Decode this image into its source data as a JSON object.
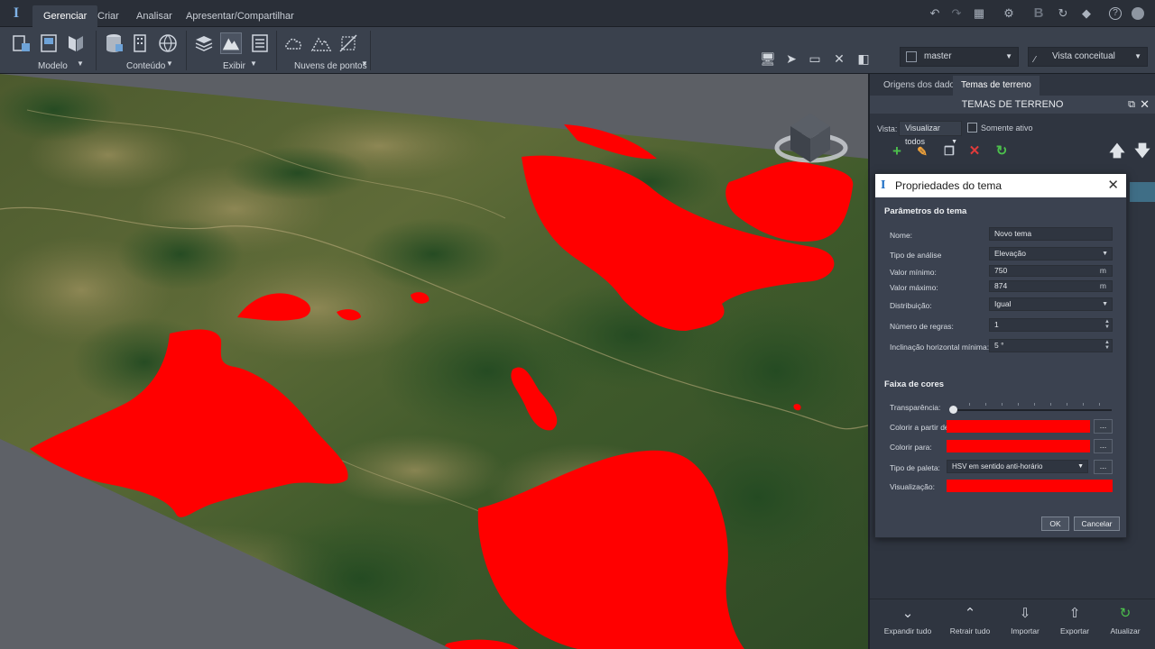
{
  "menu": {
    "tabs": [
      "Gerenciar",
      "Criar",
      "Analisar",
      "Apresentar/Compartilhar"
    ],
    "active": "Gerenciar"
  },
  "ribbon": {
    "groups": [
      "Modelo",
      "Conteúdo",
      "Exibir",
      "Nuvens de pontos"
    ],
    "branch_select": "master",
    "view_select": "Vista conceitual"
  },
  "panel": {
    "tabs": [
      "Origens dos dados",
      "Temas de terreno"
    ],
    "header": "TEMAS DE TERRENO",
    "vista_label": "Vista:",
    "vista_value": "Visualizar todos",
    "somente_ativo": "Somente ativo"
  },
  "bottom": {
    "buttons": [
      "Expandir tudo",
      "Retrair tudo",
      "Importar",
      "Exportar",
      "Atualizar"
    ]
  },
  "dialog": {
    "title": "Propriedades do tema",
    "section_params": "Parâmetros do tema",
    "nome_label": "Nome:",
    "nome_value": "Novo tema",
    "tipo_label": "Tipo de análise",
    "tipo_value": "Elevação",
    "min_label": "Valor mínimo:",
    "min_value": "750",
    "min_unit": "m",
    "max_label": "Valor máximo:",
    "max_value": "874",
    "max_unit": "m",
    "dist_label": "Distribuição:",
    "dist_value": "Igual",
    "regras_label": "Número de regras:",
    "regras_value": "1",
    "incl_label": "Inclinação horizontal mínima:",
    "incl_value": "5 °",
    "section_cores": "Faixa de cores",
    "transp_label": "Transparência:",
    "transparencia_value": 0,
    "colorir_de_label": "Colorir a partir de:",
    "colorir_para_label": "Colorir para:",
    "paleta_label": "Tipo de paleta:",
    "paleta_value": "HSV em sentido anti-horário",
    "visualizacao_label": "Visualização:",
    "ellipsis": "...",
    "ok": "OK",
    "cancel": "Cancelar",
    "color": "#ff0000"
  }
}
